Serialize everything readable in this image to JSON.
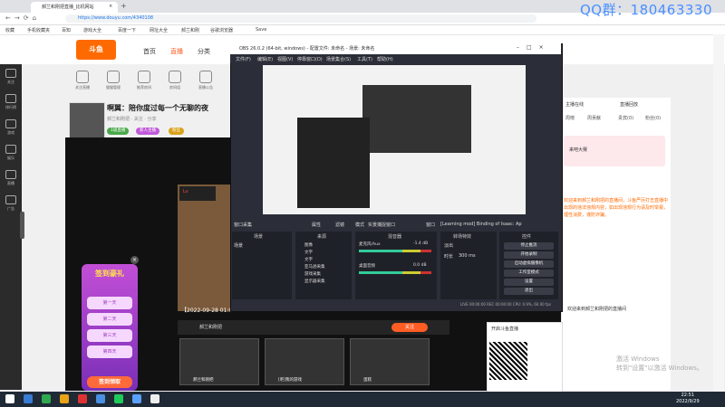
{
  "browser": {
    "tab_title": "郝兰和刚把直播_比机网站",
    "url": "https://www.douyu.com/4340108",
    "bookmarks": [
      "收藏",
      "手机收藏夹",
      "百知",
      "游戏大全",
      "百度一下",
      "网址大全",
      "郝兰和刚",
      "谷歌浏览器",
      "谷歌翻译",
      "百度",
      "Save"
    ]
  },
  "overlay_text": "QQ群：180463330",
  "site": {
    "logo": "斗鱼",
    "nav": [
      "首页",
      "直播",
      "分类"
    ],
    "rail": [
      "关注",
      "排行榜",
      "游戏",
      "娱乐",
      "直播",
      "广告"
    ],
    "tools": [
      "关注直播",
      "猫猫管理",
      "推荐房间",
      "房间组",
      "直播公告"
    ]
  },
  "streamer": {
    "title": "啊翼：陪你度过每一个无聊的夜",
    "meta": "郝兰和刚把 · 关注 · 分享",
    "badges": [
      "1级直播",
      "新人主播",
      "粉丝"
    ]
  },
  "video": {
    "date": "【2022-09-28 01:04",
    "hp": "Lv",
    "strip_label": "郝兰和刚把",
    "follow": "关注",
    "thumbs": [
      "郝兰和刚把",
      "[吧]我的游戏",
      "蛋糕"
    ]
  },
  "gift": {
    "title": "签到豪礼",
    "days": [
      "第一天",
      "第二天",
      "第三天",
      "第四天"
    ],
    "button": "签到领取",
    "close": "×"
  },
  "right_panel": {
    "head": "主播在线",
    "rank": "直播回放",
    "tabs": [
      "周榜",
      "周贡献",
      "贵宾(0)",
      "粉丝(0)"
    ],
    "ad": "来吧大赛",
    "chat": "欢迎来到郝兰和刚把的直播间，斗鱼严厉打击直播中出现的违法违规内容，如出现违规行为请及时举报，理性消费，谨防诈骗。",
    "chat2": "欢迎来到郝兰和刚把的直播间"
  },
  "qr": {
    "title": "开启斗鱼直播"
  },
  "watermark": [
    "激活 Windows",
    "转到\"设置\"以激活 Windows。"
  ],
  "obs": {
    "title": "OBS 26.0.2 (64-bit, windows) - 配置文件: 未命名 - 场景: 未命名",
    "menu": [
      "文件(F)",
      "编辑(E)",
      "视图(V)",
      "停靠窗口(D)",
      "场景集合(S)",
      "工具(T)",
      "帮助(H)"
    ],
    "sourcebar": [
      "窗口采集",
      "属性",
      "滤镜",
      "模式",
      "实景捕捉窗口",
      "窗口",
      "[Learning mod] Binding of Isaac: Ap"
    ],
    "docks": [
      "场景",
      "来源",
      "混音器",
      "转场特效",
      "控件"
    ],
    "scene": "场景",
    "sources": [
      "图像",
      "文字",
      "文字",
      "亚马逊采集",
      "游戏采集",
      "显示器采集"
    ],
    "mixer": [
      {
        "name": "麦克风/Aux",
        "level": "-1.4 dB"
      },
      {
        "name": "桌面音频",
        "level": "0.0 dB"
      }
    ],
    "transition": {
      "type": "淡出",
      "duration_label": "时长",
      "duration": "300 ms"
    },
    "controls": [
      "停止推流",
      "开始录制",
      "启动虚拟摄像机",
      "工作室模式",
      "设置",
      "退出"
    ],
    "status": "LIVE 00:00:00  REC 00:00:00  CPU: 0.9%, 60.00 fps"
  },
  "taskbar": {
    "time": "22:51",
    "date": "2022/9/29"
  }
}
